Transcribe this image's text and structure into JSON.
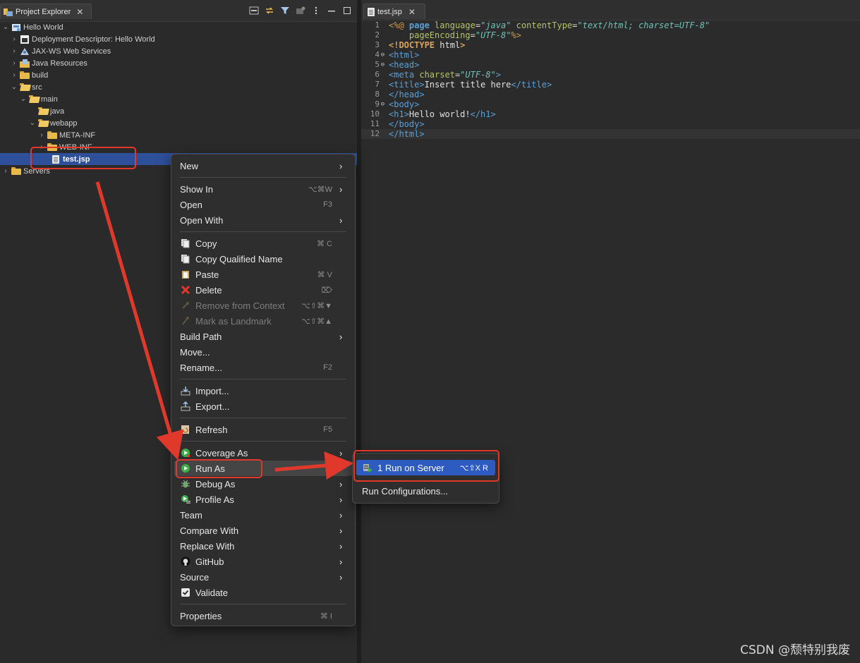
{
  "explorer": {
    "tab_label": "Project Explorer",
    "tree": [
      {
        "label": "Hello World",
        "depth": 0,
        "twisty": "down",
        "icon": "project-icon"
      },
      {
        "label": "Deployment Descriptor: Hello World",
        "depth": 1,
        "twisty": "right",
        "icon": "deployment-descriptor-icon"
      },
      {
        "label": "JAX-WS Web Services",
        "depth": 1,
        "twisty": "right",
        "icon": "webservices-icon"
      },
      {
        "label": "Java Resources",
        "depth": 1,
        "twisty": "right",
        "icon": "java-resources-icon"
      },
      {
        "label": "build",
        "depth": 1,
        "twisty": "right",
        "icon": "folder-icon"
      },
      {
        "label": "src",
        "depth": 1,
        "twisty": "down",
        "icon": "folder-icon"
      },
      {
        "label": "main",
        "depth": 2,
        "twisty": "down",
        "icon": "folder-open-icon"
      },
      {
        "label": "java",
        "depth": 3,
        "twisty": "none",
        "icon": "folder-open-icon"
      },
      {
        "label": "webapp",
        "depth": 3,
        "twisty": "down",
        "icon": "folder-open-icon"
      },
      {
        "label": "META-INF",
        "depth": 4,
        "twisty": "right",
        "icon": "folder-icon"
      },
      {
        "label": "WEB-INF",
        "depth": 4,
        "twisty": "right",
        "icon": "folder-icon"
      },
      {
        "label": "test.jsp",
        "depth": 4,
        "twisty": "none",
        "icon": "jsp-file-icon",
        "selected": true
      },
      {
        "label": "Servers",
        "depth": 0,
        "twisty": "right",
        "icon": "folder-icon"
      }
    ]
  },
  "editor": {
    "tab_label": "test.jsp",
    "line_numbers": [
      "1",
      "2",
      "3",
      "4",
      "5",
      "6",
      "7",
      "8",
      "9",
      "10",
      "11",
      "12"
    ]
  },
  "context_menu": {
    "items": [
      {
        "label": "New",
        "shortcut": "",
        "submenu": true,
        "icon": ""
      },
      {
        "label": "Show In",
        "shortcut": "⌥⌘W",
        "submenu": true,
        "icon": ""
      },
      {
        "label": "Open",
        "shortcut": "F3",
        "submenu": false,
        "icon": ""
      },
      {
        "label": "Open With",
        "shortcut": "",
        "submenu": true,
        "icon": ""
      },
      {
        "label": "Copy",
        "shortcut": "⌘ C",
        "submenu": false,
        "icon": "copy-icon"
      },
      {
        "label": "Copy Qualified Name",
        "shortcut": "",
        "submenu": false,
        "icon": "copy-qualified-icon"
      },
      {
        "label": "Paste",
        "shortcut": "⌘ V",
        "submenu": false,
        "icon": "paste-icon"
      },
      {
        "label": "Delete",
        "shortcut": "⌦",
        "submenu": false,
        "icon": "delete-icon"
      },
      {
        "label": "Remove from Context",
        "shortcut": "⌥⇧⌘▼",
        "submenu": false,
        "icon": "remove-context-icon",
        "disabled": true
      },
      {
        "label": "Mark as Landmark",
        "shortcut": "⌥⇧⌘▲",
        "submenu": false,
        "icon": "landmark-icon",
        "disabled": true
      },
      {
        "label": "Build Path",
        "shortcut": "",
        "submenu": true,
        "icon": ""
      },
      {
        "label": "Move...",
        "shortcut": "",
        "submenu": false,
        "icon": ""
      },
      {
        "label": "Rename...",
        "shortcut": "F2",
        "submenu": false,
        "icon": ""
      },
      {
        "label": "Import...",
        "shortcut": "",
        "submenu": false,
        "icon": "import-icon"
      },
      {
        "label": "Export...",
        "shortcut": "",
        "submenu": false,
        "icon": "export-icon"
      },
      {
        "label": "Refresh",
        "shortcut": "F5",
        "submenu": false,
        "icon": "refresh-icon"
      },
      {
        "label": "Coverage As",
        "shortcut": "",
        "submenu": true,
        "icon": "coverage-icon"
      },
      {
        "label": "Run As",
        "shortcut": "",
        "submenu": true,
        "icon": "run-icon",
        "highlighted": true
      },
      {
        "label": "Debug As",
        "shortcut": "",
        "submenu": true,
        "icon": "debug-icon"
      },
      {
        "label": "Profile As",
        "shortcut": "",
        "submenu": true,
        "icon": "profile-icon"
      },
      {
        "label": "Team",
        "shortcut": "",
        "submenu": true,
        "icon": ""
      },
      {
        "label": "Compare With",
        "shortcut": "",
        "submenu": true,
        "icon": ""
      },
      {
        "label": "Replace With",
        "shortcut": "",
        "submenu": true,
        "icon": ""
      },
      {
        "label": "GitHub",
        "shortcut": "",
        "submenu": true,
        "icon": "github-icon"
      },
      {
        "label": "Source",
        "shortcut": "",
        "submenu": true,
        "icon": ""
      },
      {
        "label": "Validate",
        "shortcut": "",
        "submenu": false,
        "icon": "checkbox-icon"
      },
      {
        "label": "Properties",
        "shortcut": "⌘ I",
        "submenu": false,
        "icon": ""
      }
    ]
  },
  "submenu": {
    "items": [
      {
        "label": "1 Run on Server",
        "shortcut": "⌥⇧X R",
        "active": true
      },
      {
        "label": "Run Configurations...",
        "shortcut": "",
        "active": false
      }
    ]
  },
  "watermark": "CSDN @颓特别我废",
  "colors": {
    "selection": "#2e4f9a",
    "submenu_active": "#2d5bbf",
    "annotation_red": "#e0392b"
  }
}
